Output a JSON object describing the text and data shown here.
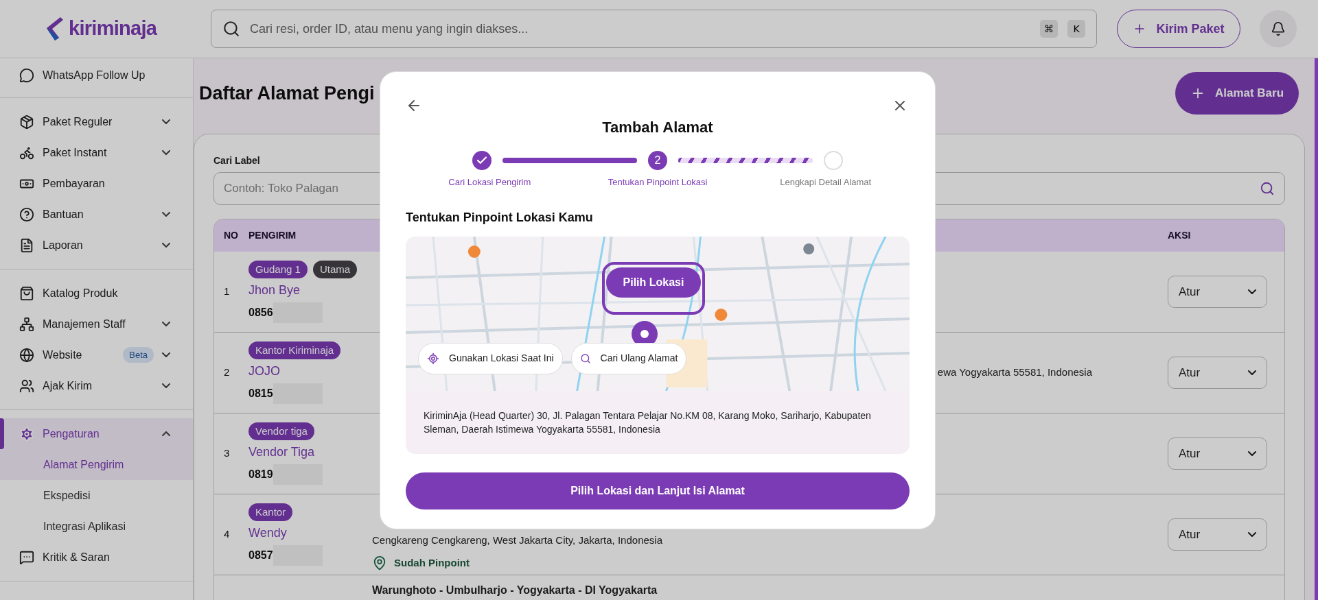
{
  "header": {
    "logo": "kiriminaja",
    "search": {
      "placeholder": "Cari resi, order ID, atau menu yang ingin diakses...",
      "keys": [
        "⌘",
        "K"
      ]
    },
    "send_button": "Kirim Paket"
  },
  "sidebar": {
    "groups": [
      {
        "items": [
          {
            "label": "WhatsApp Follow Up",
            "selected": false
          }
        ]
      },
      {
        "items": [
          {
            "label": "Paket Reguler",
            "expanded": false,
            "selected": false
          },
          {
            "label": "Paket Instant",
            "expanded": false,
            "selected": false
          },
          {
            "label": "Pembayaran",
            "selected": false
          },
          {
            "label": "Bantuan",
            "expanded": false,
            "selected": false
          },
          {
            "label": "Laporan",
            "expanded": false,
            "selected": false
          }
        ]
      },
      {
        "items": [
          {
            "label": "Katalog Produk",
            "selected": false
          },
          {
            "label": "Manajemen Staff",
            "expanded": false,
            "selected": false
          },
          {
            "label": "Website",
            "badge": "Beta",
            "expanded": false,
            "selected": false
          },
          {
            "label": "Ajak Kirim",
            "expanded": false,
            "selected": false
          }
        ]
      },
      {
        "items": [
          {
            "label": "Pengaturan",
            "expanded": true,
            "selected": true,
            "children": [
              {
                "label": "Alamat Pengirim",
                "selected": true
              },
              {
                "label": "Ekspedisi",
                "selected": false
              },
              {
                "label": "Integrasi Aplikasi",
                "selected": false
              }
            ]
          },
          {
            "label": "Kritik & Saran",
            "selected": false
          }
        ]
      }
    ]
  },
  "page": {
    "title": "Daftar Alamat Pengi",
    "new_button": "Alamat Baru",
    "filter": {
      "label": "Cari Label",
      "placeholder": "Contoh: Toko Palagan"
    },
    "table": {
      "columns": [
        "NO",
        "PENGIRIM",
        "AKSI"
      ],
      "rows": [
        {
          "no": "1",
          "tags": [
            {
              "text": "Gudang 1",
              "kind": "label"
            },
            {
              "text": "Utama",
              "kind": "primary"
            }
          ],
          "name": "Jhon Bye",
          "phone": "0856",
          "action": "Atur"
        },
        {
          "no": "2",
          "tags": [
            {
              "text": "Kantor Kiriminaja",
              "kind": "label"
            }
          ],
          "name": "JOJO",
          "phone": "0815",
          "address": "ewa Yogyakarta 55581, Indonesia",
          "partly_covered": true,
          "action": "Atur"
        },
        {
          "no": "3",
          "tags": [
            {
              "text": "Vendor tiga",
              "kind": "label"
            }
          ],
          "name": "Vendor Tiga",
          "phone": "0819",
          "action": "Atur"
        },
        {
          "no": "4",
          "tags": [
            {
              "text": "Kantor",
              "kind": "label"
            }
          ],
          "name": "Wendy",
          "phone": "0857",
          "address": "Cengkareng Cengkareng, West Jakarta City, Jakarta, Indonesia",
          "pinpoint": "Sudah Pinpoint",
          "action": "Atur"
        },
        {
          "address": "Warunghoto - Umbulharjo - Yogyakarta - DI Yogyakarta"
        }
      ]
    }
  },
  "dialog": {
    "title": "Tambah Alamat",
    "steps": [
      {
        "label": "Cari Lokasi Pengirim",
        "done": true,
        "current": false
      },
      {
        "label": "Tentukan Pinpoint Lokasi",
        "number": "2",
        "done": false,
        "current": true
      },
      {
        "label": "Lengkapi Detail Alamat",
        "done": false,
        "current": false
      }
    ],
    "connectors": [
      {
        "complete": true
      },
      {
        "complete": false
      }
    ],
    "section_title": "Tentukan Pinpoint Lokasi Kamu",
    "map": {
      "kind": "picture",
      "tooltip": "Pilih Lokasi",
      "buttons": [
        "Gunakan Lokasi Saat Ini",
        "Cari Ulang Alamat"
      ]
    },
    "address": "KiriminAja (Head Quarter) 30, Jl. Palagan Tentara Pelajar No.KM 08, Karang Moko, Sariharjo, Kabupaten Sleman, Daerah Istimewa Yogyakarta 55581, Indonesia",
    "confirm_button": "Pilih Lokasi dan Lanjut Isi Alamat"
  }
}
